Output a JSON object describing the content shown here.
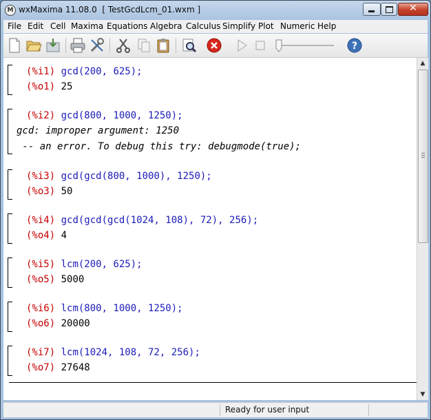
{
  "window": {
    "title": "wxMaxima 11.08.0  [ TestGcdLcm_01.wxm ]",
    "app_icon": "maxima-icon"
  },
  "menu": [
    "File",
    "Edit",
    "Cell",
    "Maxima",
    "Equations",
    "Algebra",
    "Calculus",
    "Simplify",
    "Plot",
    "Numeric",
    "Help"
  ],
  "toolbar": {
    "icons": [
      "new-file-icon",
      "open-folder-icon",
      "save-icon",
      "print-icon",
      "configure-icon",
      "cut-icon",
      "copy-icon",
      "paste-icon",
      "find-icon",
      "interrupt-icon",
      "play-icon",
      "stop-icon",
      "slider-icon",
      "help-icon"
    ]
  },
  "worksheet": {
    "cells": [
      {
        "in_label": "(%i1)",
        "input": "gcd(200, 625);",
        "out_label": "(%o1)",
        "output": "25"
      },
      {
        "in_label": "(%i2)",
        "input": "gcd(800, 1000, 1250);",
        "error_lines": [
          "gcd: improper argument: 1250",
          " -- an error. To debug this try: debugmode(true);"
        ]
      },
      {
        "in_label": "(%i3)",
        "input": "gcd(gcd(800, 1000), 1250);",
        "out_label": "(%o3)",
        "output": "50"
      },
      {
        "in_label": "(%i4)",
        "input": "gcd(gcd(gcd(1024, 108), 72), 256);",
        "out_label": "(%o4)",
        "output": "4"
      },
      {
        "in_label": "(%i5)",
        "input": "lcm(200, 625);",
        "out_label": "(%o5)",
        "output": "5000"
      },
      {
        "in_label": "(%i6)",
        "input": "lcm(800, 1000, 1250);",
        "out_label": "(%o6)",
        "output": "20000"
      },
      {
        "in_label": "(%i7)",
        "input": "lcm(1024, 108, 72, 256);",
        "out_label": "(%o7)",
        "output": "27648"
      }
    ]
  },
  "status": {
    "text": "Ready for user input"
  },
  "colors": {
    "input_label": "#c40000",
    "input_code": "#1a1ab8",
    "output_text": "#000000"
  }
}
